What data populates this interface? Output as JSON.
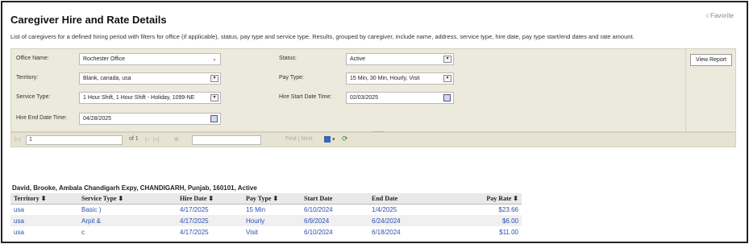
{
  "header": {
    "title": "Caregiver Hire and Rate Details",
    "favorite": "☆Favorite",
    "description": "List of caregivers for a defined hiring period with filters for office (if applicable), status, pay type and service type. Results, grouped by caregiver, include name, address, service type, hire date, pay type start/end dates and rate amount."
  },
  "filters": {
    "office": {
      "label": "Office Name:",
      "value": "Rochester Office"
    },
    "territory": {
      "label": "Territory:",
      "value": "Blank, canada, usa"
    },
    "service_type": {
      "label": "Service Type:",
      "value": "1 Hour Shift, 1 Hour Shift - Holiday, 1099-NE"
    },
    "hire_end": {
      "label": "Hire End Date Time:",
      "value": "04/28/2025"
    },
    "status": {
      "label": "Status:",
      "value": "Active"
    },
    "pay_type": {
      "label": "Pay Type:",
      "value": "15 Min, 30 Min, Hourly, Visit"
    },
    "hire_start": {
      "label": "Hire Start Date Time:",
      "value": "02/03/2025"
    },
    "view_report": "View Report"
  },
  "toolbar": {
    "first": "|◁",
    "prev": "◁",
    "page_value": "1",
    "of_pages": "of 1",
    "next": "▷",
    "last": "▷|",
    "zoom": "⊕",
    "find_next": "Find | Next",
    "save_menu": "▾"
  },
  "report": {
    "group_header": "David, Brooke,  Ambala Chandigarh Expy, CHANDIGARH, Punjab, 160101, Active",
    "columns": [
      "Territory ⬍",
      "Service Type ⬍",
      "Hire Date ⬍",
      "Pay Type ⬍",
      "Start Date",
      "End Date",
      "Pay Rate ⬍"
    ],
    "rows": [
      [
        "usa",
        "Basic )",
        "4/17/2025",
        "15 Min",
        "6/10/2024",
        "1/4/2025",
        "$23.66"
      ],
      [
        "usa",
        "Arpit &",
        "4/17/2025",
        "Hourly",
        "6/9/2024",
        "6/24/2024",
        "$6.00"
      ],
      [
        "usa",
        "c",
        "4/17/2025",
        "Visit",
        "6/10/2024",
        "6/18/2024",
        "$11.00"
      ]
    ]
  }
}
